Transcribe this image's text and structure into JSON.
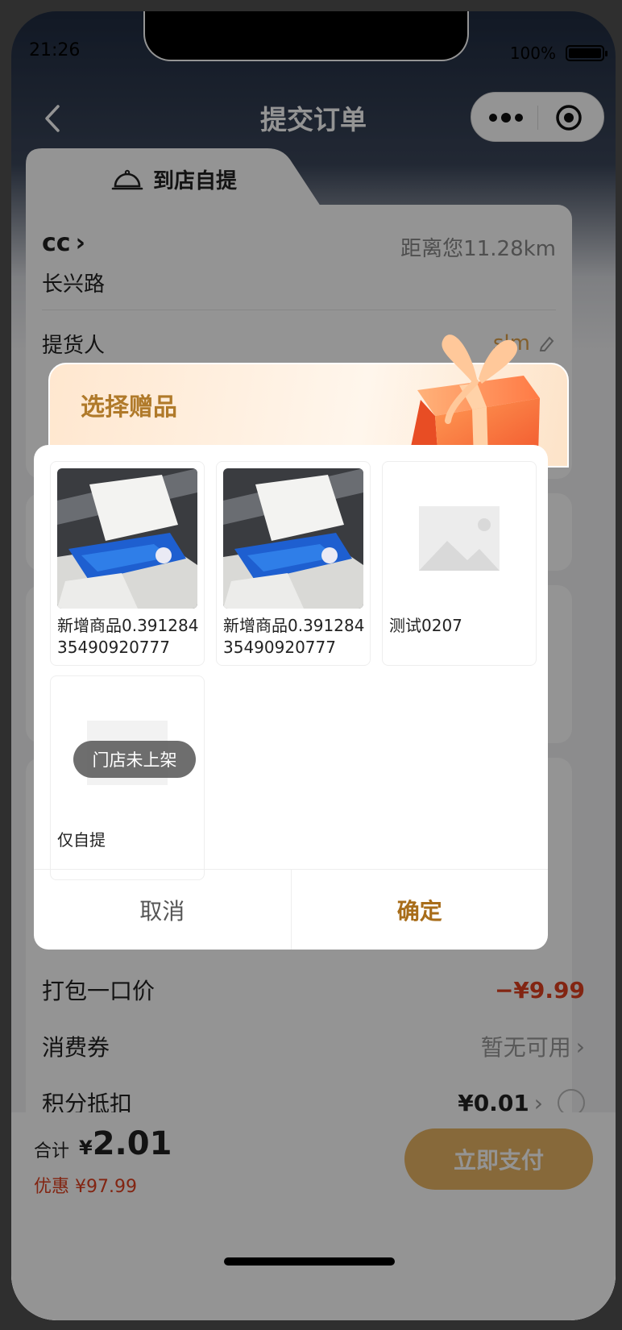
{
  "status_bar": {
    "time": "21:26",
    "battery": "100%"
  },
  "nav": {
    "title": "提交订单"
  },
  "tab": {
    "label": "到店自提"
  },
  "store": {
    "name": "cc",
    "name_chevron": "›",
    "address": "长兴路",
    "distance": "距离您11.28km"
  },
  "pickup": {
    "label": "提货人",
    "value": "slm"
  },
  "summary": {
    "bundle_label": "打包一口价",
    "bundle_value": "−¥9.99",
    "coupon_label": "消费券",
    "coupon_value": "暂无可用",
    "points_label": "积分抵扣",
    "points_value": "¥0.01"
  },
  "bottom": {
    "total_label": "合计",
    "currency": "¥",
    "total_value": "2.01",
    "discount": "优惠 ¥97.99",
    "pay_label": "立即支付"
  },
  "modal": {
    "title": "选择赠品",
    "items": [
      {
        "name": "新增商品0.39128435490920777",
        "image": "tissue-photo"
      },
      {
        "name": "新增商品0.39128435490920777",
        "image": "tissue-photo"
      },
      {
        "name": "测试0207",
        "image": "placeholder-image-icon"
      },
      {
        "name": "仅自提",
        "image": "placeholder-image-icon",
        "badge": "门店未上架"
      }
    ],
    "cancel_label": "取消",
    "confirm_label": "确定"
  },
  "colors": {
    "accent": "#e9b565",
    "price_red": "#e1401f",
    "confirm_text": "#a86d1a",
    "title_gold": "#b07a2a"
  }
}
